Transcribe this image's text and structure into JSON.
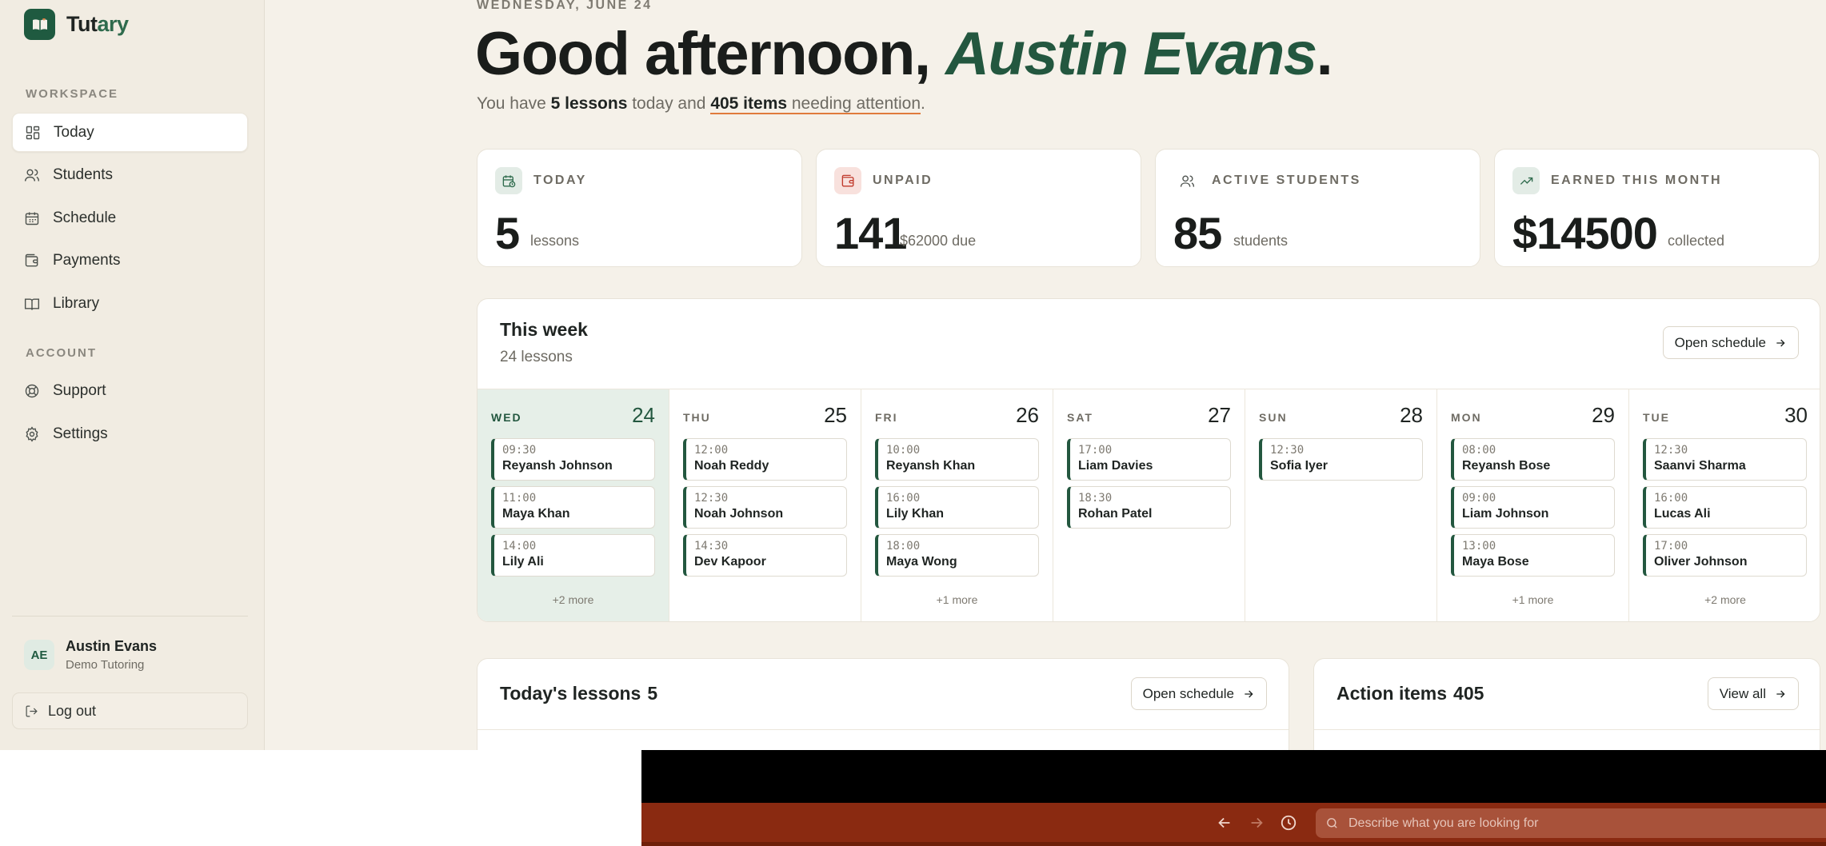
{
  "app": {
    "name_part1": "Tut",
    "name_part2": "ary"
  },
  "sidebar": {
    "workspace_label": "WORKSPACE",
    "account_label": "ACCOUNT",
    "items": [
      {
        "label": "Today",
        "icon": "grid-icon"
      },
      {
        "label": "Students",
        "icon": "users-icon"
      },
      {
        "label": "Schedule",
        "icon": "calendar-icon"
      },
      {
        "label": "Payments",
        "icon": "wallet-icon"
      },
      {
        "label": "Library",
        "icon": "book-icon"
      }
    ],
    "account_items": [
      {
        "label": "Support",
        "icon": "lifebuoy-icon"
      },
      {
        "label": "Settings",
        "icon": "gear-icon"
      }
    ],
    "user": {
      "initials": "AE",
      "name": "Austin Evans",
      "org": "Demo Tutoring"
    },
    "logout_label": "Log out"
  },
  "header": {
    "date": "WEDNESDAY, JUNE 24",
    "greeting_prefix": "Good afternoon, ",
    "user_name": "Austin Evans",
    "greeting_suffix": ".",
    "summary": {
      "p1": "You have ",
      "lessons": "5 lessons",
      "p2": " today and ",
      "items": "405 items",
      "p3": " needing attention",
      "p4": "."
    }
  },
  "stats": [
    {
      "label": "TODAY",
      "value": "5",
      "sub": "lessons",
      "icon": "calendar-clock-icon",
      "color": "#2f6b4d"
    },
    {
      "label": "UNPAID",
      "value": "141",
      "sub": "$62000 due",
      "icon": "wallet-icon",
      "color": "#c0392b"
    },
    {
      "label": "ACTIVE STUDENTS",
      "value": "85",
      "sub": "students",
      "icon": "users-icon",
      "color": "#4d524e"
    },
    {
      "label": "EARNED THIS MONTH",
      "value": "$14500",
      "sub": "collected",
      "icon": "trending-up-icon",
      "color": "#2f6b4d"
    }
  ],
  "week": {
    "title": "This week",
    "subtitle": "24 lessons",
    "button": "Open schedule",
    "days": [
      {
        "name": "WED",
        "num": "24",
        "lessons": [
          {
            "time": "09:30",
            "name": "Reyansh Johnson"
          },
          {
            "time": "11:00",
            "name": "Maya Khan"
          },
          {
            "time": "14:00",
            "name": "Lily Ali"
          }
        ],
        "more": "+2 more"
      },
      {
        "name": "THU",
        "num": "25",
        "lessons": [
          {
            "time": "12:00",
            "name": "Noah Reddy"
          },
          {
            "time": "12:30",
            "name": "Noah Johnson"
          },
          {
            "time": "14:30",
            "name": "Dev Kapoor"
          }
        ],
        "more": ""
      },
      {
        "name": "FRI",
        "num": "26",
        "lessons": [
          {
            "time": "10:00",
            "name": "Reyansh Khan"
          },
          {
            "time": "16:00",
            "name": "Lily Khan"
          },
          {
            "time": "18:00",
            "name": "Maya Wong"
          }
        ],
        "more": "+1 more"
      },
      {
        "name": "SAT",
        "num": "27",
        "lessons": [
          {
            "time": "17:00",
            "name": "Liam Davies"
          },
          {
            "time": "18:30",
            "name": "Rohan Patel"
          }
        ],
        "more": ""
      },
      {
        "name": "SUN",
        "num": "28",
        "lessons": [
          {
            "time": "12:30",
            "name": "Sofia Iyer"
          }
        ],
        "more": ""
      },
      {
        "name": "MON",
        "num": "29",
        "lessons": [
          {
            "time": "08:00",
            "name": "Reyansh Bose"
          },
          {
            "time": "09:00",
            "name": "Liam Johnson"
          },
          {
            "time": "13:00",
            "name": "Maya Bose"
          }
        ],
        "more": "+1 more"
      },
      {
        "name": "TUE",
        "num": "30",
        "lessons": [
          {
            "time": "12:30",
            "name": "Saanvi Sharma"
          },
          {
            "time": "16:00",
            "name": "Lucas Ali"
          },
          {
            "time": "17:00",
            "name": "Oliver Johnson"
          }
        ],
        "more": "+2 more"
      }
    ]
  },
  "todays_lessons": {
    "title": "Today's lessons",
    "count": "5",
    "button": "Open schedule"
  },
  "action_items": {
    "title": "Action items",
    "count": "405",
    "button": "View all"
  },
  "browser": {
    "search_placeholder": "Describe what you are looking for"
  }
}
